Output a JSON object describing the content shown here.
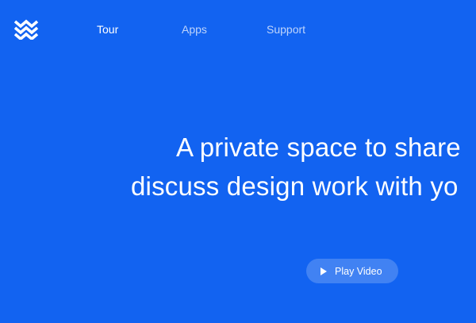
{
  "brand": {
    "logo_icon": "zigzag-wave-logo-icon"
  },
  "nav": {
    "items": [
      {
        "label": "Tour",
        "active": true
      },
      {
        "label": "Apps",
        "active": false
      },
      {
        "label": "Support",
        "active": false
      }
    ]
  },
  "hero": {
    "line1": "A private space to share",
    "line2": "discuss design work with yo"
  },
  "cta": {
    "play_label": "Play Video",
    "icon": "play-icon"
  },
  "colors": {
    "background": "#1263f1",
    "text": "#ffffff"
  }
}
